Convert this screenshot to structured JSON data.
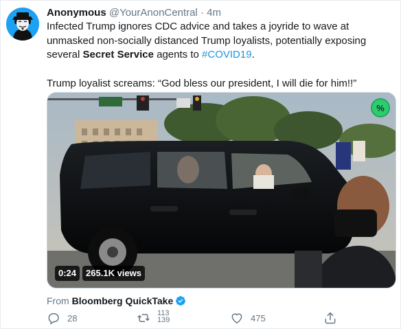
{
  "tweet": {
    "display_name": "Anonymous",
    "handle": "@YourAnonCentral",
    "separator": "·",
    "time": "4m",
    "text_line1_part1": "Infected Trump ignores CDC advice and takes a joyride to wave at unmasked non-socially distanced Trump loyalists, potentially exposing several ",
    "text_bold": "Secret Service",
    "text_line1_part2": " agents to ",
    "hashtag": "#COVID19",
    "text_line1_part3": ".",
    "text_para2": "Trump loyalist screams:   “God bless our president, I will die for him!!”"
  },
  "media": {
    "duration": "0:24",
    "views": "265.1K views",
    "badge_icon": "percent-badge-icon",
    "badge_label": "%"
  },
  "from": {
    "prefix": "From",
    "source": "Bloomberg QuickTake"
  },
  "actions": {
    "reply_count": "28",
    "retweet_count_old": "113",
    "retweet_count_new": "139",
    "like_count": "475"
  },
  "colors": {
    "link": "#1b95e0",
    "muted": "#657786",
    "text": "#14171a",
    "verified": "#1da1f2",
    "badge": "#2ecc71"
  }
}
